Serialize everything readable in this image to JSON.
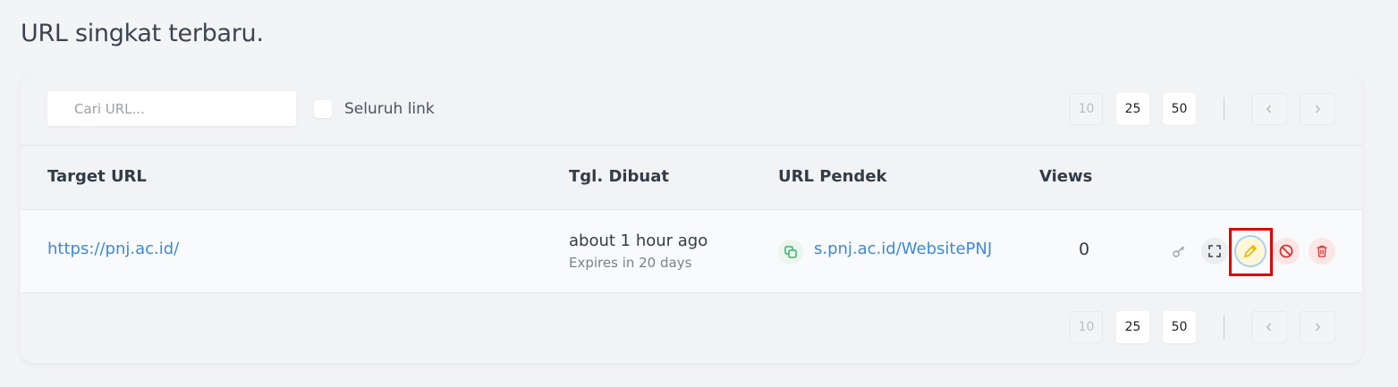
{
  "page": {
    "title": "URL singkat terbaru."
  },
  "toolbar": {
    "search_placeholder": "Cari URL...",
    "all_links_label": "Seluruh link",
    "page_sizes": [
      "10",
      "25",
      "50"
    ]
  },
  "table": {
    "headers": {
      "target": "Target URL",
      "created": "Tgl. Dibuat",
      "short": "URL Pendek",
      "views": "Views"
    },
    "rows": [
      {
        "target_url": "https://pnj.ac.id/",
        "created": "about 1 hour ago",
        "expires": "Expires in 20 days",
        "short_url": "s.pnj.ac.id/WebsitePNJ",
        "views": "0",
        "actions": [
          "key-icon",
          "qr-code-icon",
          "edit-icon",
          "ban-icon",
          "trash-icon"
        ]
      }
    ]
  },
  "colors": {
    "link": "#3b8ad9",
    "highlight": "#e00000",
    "edit": "#e8b400",
    "danger": "#d63333",
    "copy": "#3bb36a"
  }
}
